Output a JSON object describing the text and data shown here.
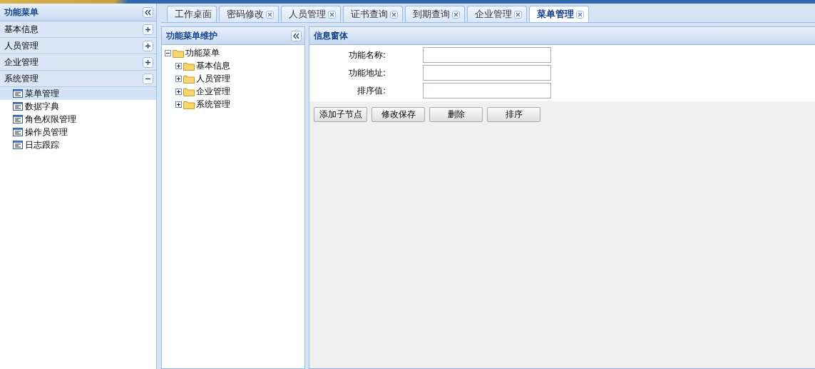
{
  "sidebar": {
    "title": "功能菜单",
    "sections": [
      {
        "label": "基本信息",
        "expanded": false
      },
      {
        "label": "人员管理",
        "expanded": false
      },
      {
        "label": "企业管理",
        "expanded": false
      },
      {
        "label": "系统管理",
        "expanded": true,
        "items": [
          {
            "label": "菜单管理",
            "selected": true
          },
          {
            "label": "数据字典",
            "selected": false
          },
          {
            "label": "角色权限管理",
            "selected": false
          },
          {
            "label": "操作员管理",
            "selected": false
          },
          {
            "label": "日志跟踪",
            "selected": false
          }
        ]
      }
    ]
  },
  "tabs": [
    {
      "label": "工作桌面",
      "selected": false,
      "closable": false
    },
    {
      "label": "密码修改",
      "selected": false,
      "closable": true
    },
    {
      "label": "人员管理",
      "selected": false,
      "closable": true
    },
    {
      "label": "证书查询",
      "selected": false,
      "closable": true
    },
    {
      "label": "到期查询",
      "selected": false,
      "closable": true
    },
    {
      "label": "企业管理",
      "selected": false,
      "closable": true
    },
    {
      "label": "菜单管理",
      "selected": true,
      "closable": true
    }
  ],
  "tree_panel": {
    "title": "功能菜单维护",
    "tree": [
      {
        "label": "功能菜单",
        "expanded": true,
        "children": [
          {
            "label": "基本信息",
            "expanded": false
          },
          {
            "label": "人员管理",
            "expanded": false
          },
          {
            "label": "企业管理",
            "expanded": false
          },
          {
            "label": "系统管理",
            "expanded": false
          }
        ]
      }
    ]
  },
  "form_panel": {
    "title": "信息窗体",
    "fields": [
      {
        "label": "功能名称:"
      },
      {
        "label": "功能地址:"
      },
      {
        "label": "排序值:"
      }
    ],
    "buttons": [
      "添加子节点",
      "修改保存",
      "删除",
      "排序"
    ]
  }
}
